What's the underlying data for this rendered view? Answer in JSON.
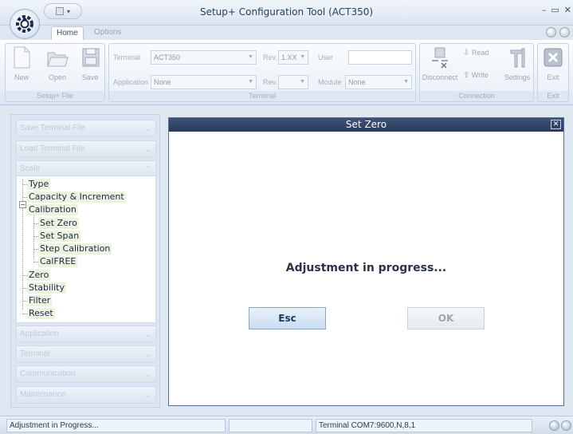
{
  "window": {
    "title": "Setup+ Configuration Tool (ACT350)",
    "controls": [
      "–",
      "▭",
      "✕"
    ]
  },
  "tabs": {
    "home": "Home",
    "options": "Options"
  },
  "ribbon": {
    "setup_file": {
      "label": "Setup+ File",
      "new": "New",
      "open": "Open",
      "save": "Save"
    },
    "terminal": {
      "label": "Terminal",
      "terminal_label": "Terminal",
      "terminal_value": "ACT350",
      "rev_label": "Rev.",
      "rev_value": "1.XX",
      "user_label": "User",
      "application_label": "Application",
      "application_value": "None",
      "rev2_label": "Rev.",
      "module_label": "Module",
      "module_value": "None"
    },
    "connection": {
      "label": "Connection",
      "disconnect": "Disconnect",
      "read": "Read",
      "write": "Write",
      "settings": "Settings"
    },
    "exit": {
      "label": "Exit",
      "exit": "Exit"
    }
  },
  "leftpanel": {
    "save_terminal_file": "Save Terminal File",
    "load_terminal_file": "Load Terminal File",
    "scale": "Scale",
    "tree": {
      "type": "Type",
      "capacity": "Capacity & Increment",
      "calibration": "Calibration",
      "set_zero": "Set Zero",
      "set_span": "Set Span",
      "step_calibration": "Step Calibration",
      "calfree": "CalFREE",
      "zero": "Zero",
      "stability": "Stability",
      "filter": "Filter",
      "reset": "Reset"
    },
    "application": "Application",
    "terminal": "Terminal",
    "communication": "Communication",
    "maintenance": "Maintenance"
  },
  "dialog": {
    "title": "Set Zero",
    "close": "✕",
    "message": "Adjustment in progress...",
    "esc": "Esc",
    "ok": "OK"
  },
  "status": {
    "left": "Adjustment in Progress...",
    "terminal": "Terminal   COM7:9600,N,8,1"
  }
}
